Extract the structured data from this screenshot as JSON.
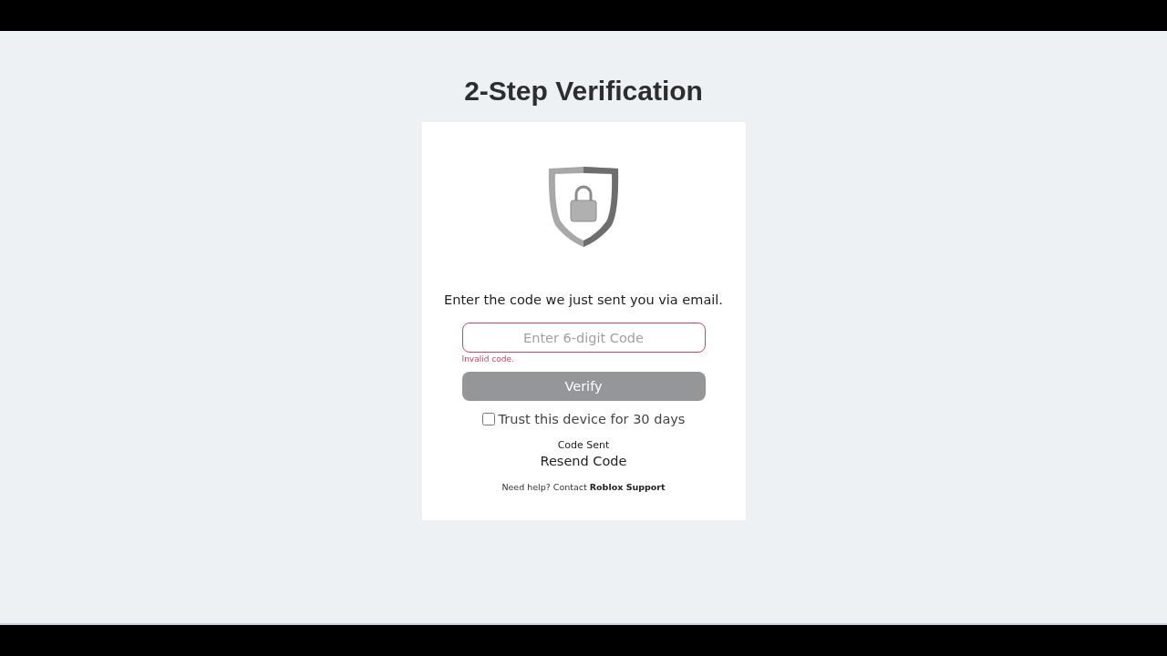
{
  "title": "2-Step Verification",
  "card": {
    "instruction": "Enter the code we just sent you via email.",
    "code_field": {
      "placeholder": "Enter 6-digit Code",
      "invalid": true,
      "error": "Invalid code."
    },
    "verify_button": {
      "label": "Verify",
      "disabled": true
    },
    "trust_device": {
      "label": "Trust this device for 30 days",
      "checked": false
    },
    "status": "Code Sent",
    "resend_link": "Resend Code",
    "help": {
      "text": "Need help? Contact",
      "link": "Roblox Support"
    }
  }
}
